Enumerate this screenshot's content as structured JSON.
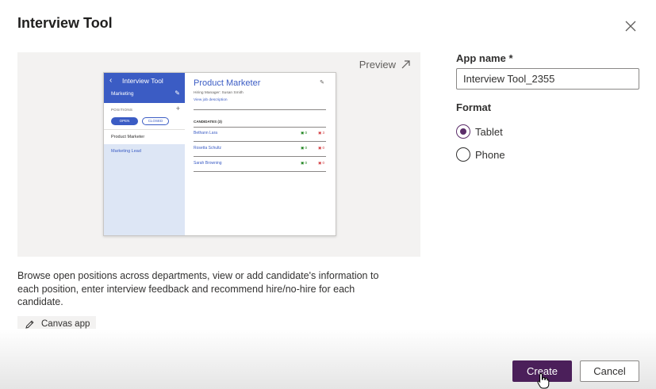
{
  "dialog": {
    "title": "Interview Tool"
  },
  "preview": {
    "link_label": "Preview",
    "mock": {
      "app_title": "Interview Tool",
      "department": "Marketing",
      "positions_label": "POSITIONS",
      "open_label": "OPEN",
      "closed_label": "CLOSED",
      "positions": [
        "Product Marketer",
        "Marketing Lead"
      ],
      "selected_title": "Product Marketer",
      "hiring_manager": "Hiring Manager: Susan Smith",
      "view_job_link": "View job description",
      "candidates_label": "CANDIDATES (3)",
      "candidates": [
        {
          "name": "Bethann Lara",
          "up": "0",
          "down": "3"
        },
        {
          "name": "Rosetta Schultz",
          "up": "0",
          "down": "0"
        },
        {
          "name": "Sarah Browning",
          "up": "0",
          "down": "0"
        }
      ]
    }
  },
  "description": "Browse open positions across departments, view or add candidate's information to each position, enter interview feedback and recommend hire/no-hire for each candidate.",
  "app_type_badge": "Canvas app",
  "form": {
    "app_name_label": "App name *",
    "app_name_value": "Interview Tool_2355",
    "format_label": "Format",
    "formats": [
      {
        "label": "Tablet",
        "selected": true
      },
      {
        "label": "Phone",
        "selected": false
      }
    ]
  },
  "footer": {
    "create_label": "Create",
    "cancel_label": "Cancel"
  },
  "colors": {
    "primary": "#4b1f5a",
    "radio_accent": "#5c2d6a",
    "mock_brand": "#3b5cc4"
  }
}
